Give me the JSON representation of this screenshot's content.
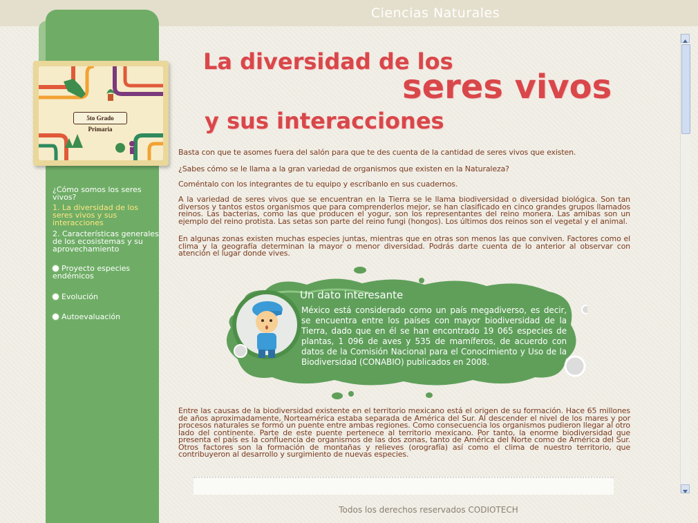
{
  "app": {
    "title": "Ciencias Naturales"
  },
  "cover": {
    "label": "5to Grado Primaria"
  },
  "sidebar": {
    "items": [
      {
        "label": "¿Cómo somos los seres vivos?",
        "active": false,
        "bullet": false
      },
      {
        "label": "1. La diversidad de los seres vivos y sus interacciones",
        "active": true,
        "bullet": false
      },
      {
        "label": "2. Características generales de los ecosistemas y su aprovechamiento",
        "active": false,
        "bullet": false
      },
      {
        "label": "Proyecto especies endémicos",
        "active": false,
        "bullet": true
      },
      {
        "label": "Evolución",
        "active": false,
        "bullet": true
      },
      {
        "label": "Autoevaluación",
        "active": false,
        "bullet": true
      }
    ]
  },
  "heading": {
    "line1": "La diversidad de los",
    "line2": "seres vivos",
    "line3": "y sus interacciones"
  },
  "content": {
    "p1": "Basta con que te asomes fuera del salón para que te des cuenta de la cantidad de seres vivos que existen.",
    "p2": "¿Sabes cómo se le llama a la gran variedad de organismos que existen en la Naturaleza?",
    "p3": "Coméntalo con los integrantes de tu equipo y escríbanlo en sus cuadernos.",
    "p4": "A la variedad de seres vivos que se encuentran en la Tierra se le llama biodiversidad o diversidad biológica. Son tan diversos y tantos estos organismos que para comprenderlos mejor, se han clasificado en cinco grandes grupos llamados reinos. Las bacterias, como las que producen el yogur, son los representantes del reino monera. Las amibas son un ejemplo del reino protista. Las setas son parte del reino fungi (hongos). Los últimos dos reinos son el vegetal y el animal.",
    "p5": "En algunas zonas existen muchas especies juntas, mientras que en otras son menos las que conviven. Factores como el clima y la geografía determinan la mayor o menor diversidad. Podrás darte cuenta de lo anterior al observar con atención el lugar donde vives.",
    "p6": "Entre las causas de la biodiversidad existente en el territorio mexicano está el origen de su formación. Hace 65 millones de años aproximadamente, Norteamérica estaba separada de América del Sur. Al descender el nivel de los mares y por procesos naturales se formó un puente entre ambas regiones. Como consecuencia los organismos pudieron llegar al otro lado del continente. Parte de este puente pertenece al territorio mexicano. Por tanto, la enorme biodiversidad que presenta el país es la confluencia de organismos de las dos zonas, tanto de América del Norte como de América del Sur. Otros factores son la formación de montañas y relieves (orografía) así como el clima de nuestro territorio, que contribuyeron al desarrollo y surgimiento de nuevas especies."
  },
  "info": {
    "title": "Un dato interesante",
    "text": "México está considerado como un país megadiverso, es decir, se encuentra entre los países con mayor biodiversidad de la Tierra, dado que en él se han encontrado 19 065 especies de plantas, 1 096 de aves y 535 de mamíferos, de acuerdo con datos de la Comisión Nacional para el Conocimiento y Uso de la Biodiversidad (CONABIO) publicados en 2008."
  },
  "footer": {
    "text": "Todos los derechos reservados CODIOTECH"
  },
  "colors": {
    "sidebar": "#6fad66",
    "heading": "#d9474a",
    "body_text": "#7a3a1e",
    "cloud": "#5f9f5a"
  }
}
